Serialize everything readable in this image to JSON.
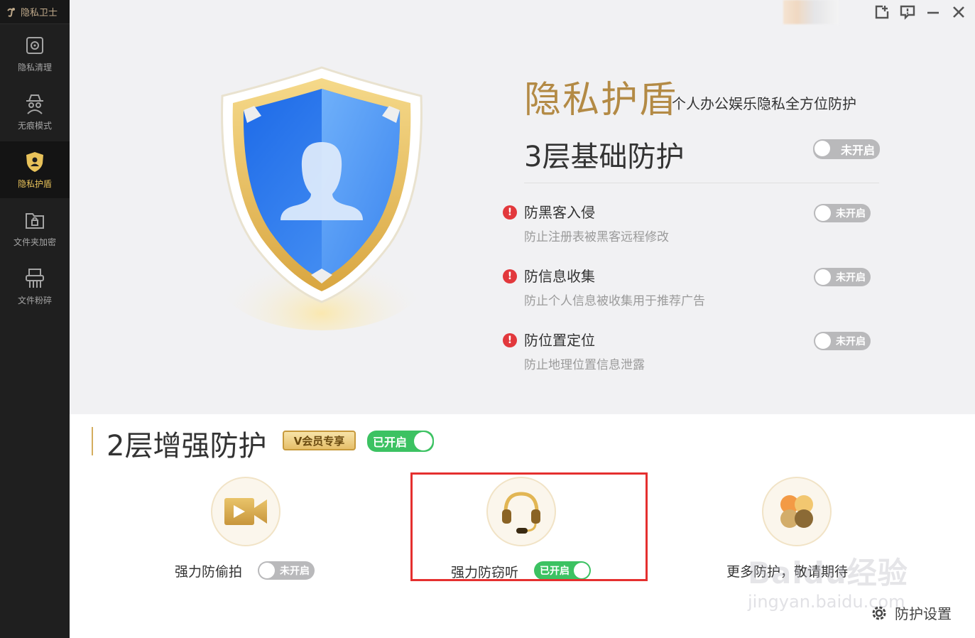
{
  "app": {
    "title": "隐私卫士"
  },
  "sidebar": {
    "items": [
      {
        "label": "隐私清理",
        "icon": "gear-icon"
      },
      {
        "label": "无痕模式",
        "icon": "spy-icon"
      },
      {
        "label": "隐私护盾",
        "icon": "shield-user-icon",
        "active": true
      },
      {
        "label": "文件夹加密",
        "icon": "folder-lock-icon"
      },
      {
        "label": "文件粉碎",
        "icon": "shredder-icon"
      }
    ]
  },
  "window": {
    "buttons": [
      "share-icon",
      "feedback-icon",
      "minimize-icon",
      "close-icon"
    ]
  },
  "hero": {
    "title": "隐私护盾",
    "subtitle": "个人办公娱乐隐私全方位防护"
  },
  "basic": {
    "title": "3层基础防护",
    "status": "未开启",
    "features": [
      {
        "name": "防黑客入侵",
        "desc": "防止注册表被黑客远程修改",
        "status": "未开启"
      },
      {
        "name": "防信息收集",
        "desc": "防止个人信息被收集用于推荐广告",
        "status": "未开启"
      },
      {
        "name": "防位置定位",
        "desc": "防止地理位置信息泄露",
        "status": "未开启"
      }
    ],
    "warn_glyph": "!"
  },
  "enhanced": {
    "title": "2层增强防护",
    "vip_badge": "V会员专享",
    "status": "已开启",
    "cards": [
      {
        "label": "强力防偷拍",
        "status": "未开启",
        "icon": "camera-icon"
      },
      {
        "label": "强力防窃听",
        "status": "已开启",
        "icon": "headset-icon"
      },
      {
        "label": "更多防护，敬请期待",
        "icon": "more-icon"
      }
    ]
  },
  "settings": {
    "label": "防护设置"
  },
  "watermark": {
    "line1": "Baidu经验",
    "line2": "jingyan.baidu.com"
  },
  "colors": {
    "accent_gold": "#b38a45",
    "on_green": "#3cc262",
    "off_gray": "#b9b9bb",
    "warn_red": "#e2383c",
    "highlight_red": "#e5302f"
  }
}
